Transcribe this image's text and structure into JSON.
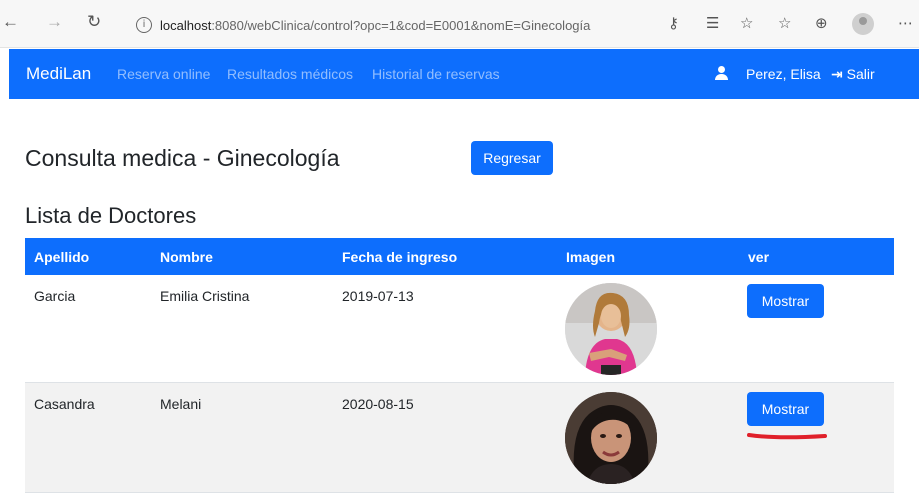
{
  "browser": {
    "url_host": "localhost",
    "url_path": ":8080/webClinica/control?opc=1&cod=E0001&nomE=Ginecología"
  },
  "navbar": {
    "brand": "MediLan",
    "links": [
      "Reserva online",
      "Resultados médicos",
      "Historial de reservas"
    ],
    "user": "Perez, Elisa",
    "logout": "Salir"
  },
  "page": {
    "title": "Consulta medica - Ginecología",
    "back_button": "Regresar",
    "section_title": "Lista de Doctores"
  },
  "table": {
    "columns": [
      "Apellido",
      "Nombre",
      "Fecha de ingreso",
      "Imagen",
      "ver"
    ],
    "rows": [
      {
        "apellido": "Garcia",
        "nombre": "Emilia Cristina",
        "fecha": "2019-07-13",
        "action": "Mostrar"
      },
      {
        "apellido": "Casandra",
        "nombre": "Melani",
        "fecha": "2020-08-15",
        "action": "Mostrar"
      }
    ]
  },
  "colors": {
    "primary": "#0d6efd",
    "annotation": "#e0202a"
  }
}
